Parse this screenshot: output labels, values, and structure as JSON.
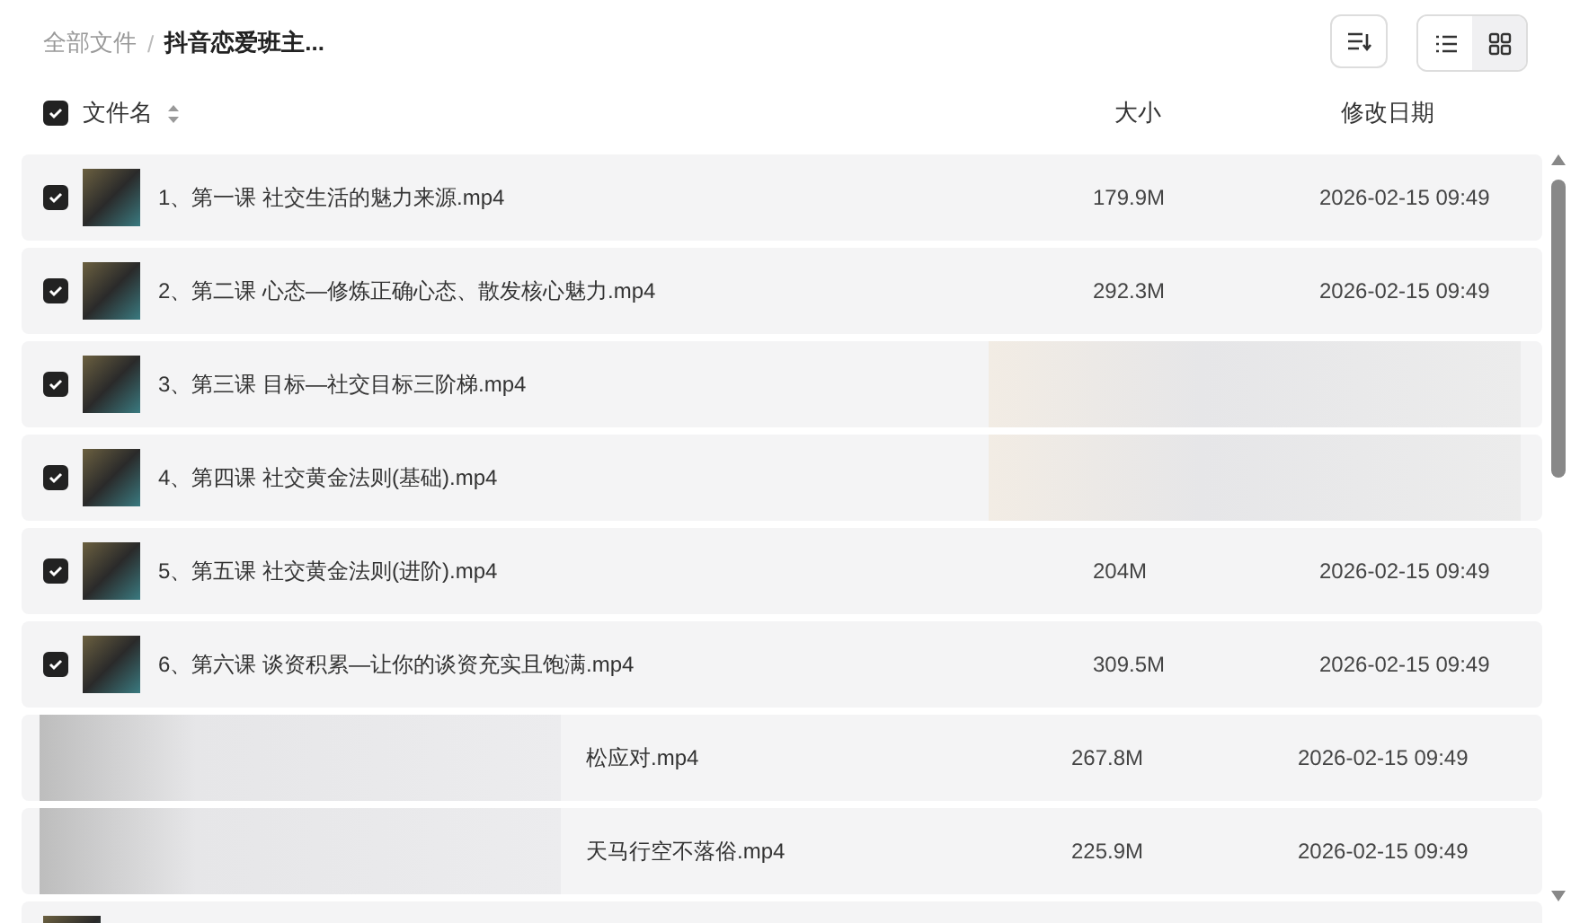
{
  "breadcrumb": [
    {
      "label": "全部文件",
      "current": false
    },
    {
      "label": "抖音恋爱班主...",
      "current": true
    }
  ],
  "breadcrumb_separator": "/",
  "views": [
    {
      "kind": "list",
      "selected": false
    },
    {
      "kind": "grid",
      "selected": true
    }
  ],
  "table": {
    "all_selected": true,
    "columns": [
      "文件名",
      "大小",
      "修改日期"
    ],
    "rows": [
      {
        "kind": "full",
        "selected": true,
        "name": "1、第一课 社交生活的魅力来源.mp4",
        "size": "179.9M",
        "date": "2026-02-15 09:49"
      },
      {
        "kind": "full",
        "selected": true,
        "name": "2、第二课 心态—修炼正确心态、散发核心魅力.mp4",
        "size": "292.3M",
        "date": "2026-02-15 09:49"
      },
      {
        "kind": "end_blurred",
        "selected": true,
        "name": "3、第三课 目标—社交目标三阶梯.mp4"
      },
      {
        "kind": "end_blurred",
        "selected": true,
        "name": "4、第四课 社交黄金法则(基础).mp4"
      },
      {
        "kind": "full",
        "selected": true,
        "name": "5、第五课 社交黄金法则(进阶).mp4",
        "size": "204M",
        "date": "2026-02-15 09:49"
      },
      {
        "kind": "full",
        "selected": true,
        "name": "6、第六课 谈资积累—让你的谈资充实且饱满.mp4",
        "size": "309.5M",
        "date": "2026-02-15 09:49"
      },
      {
        "kind": "start_blurred",
        "name": "松应对.mp4",
        "size": "267.8M",
        "date": "2026-02-15 09:49"
      },
      {
        "kind": "start_blurred",
        "name": "天马行空不落俗.mp4",
        "size": "225.9M",
        "date": "2026-02-15 09:49"
      },
      {
        "kind": "full"
      }
    ]
  }
}
